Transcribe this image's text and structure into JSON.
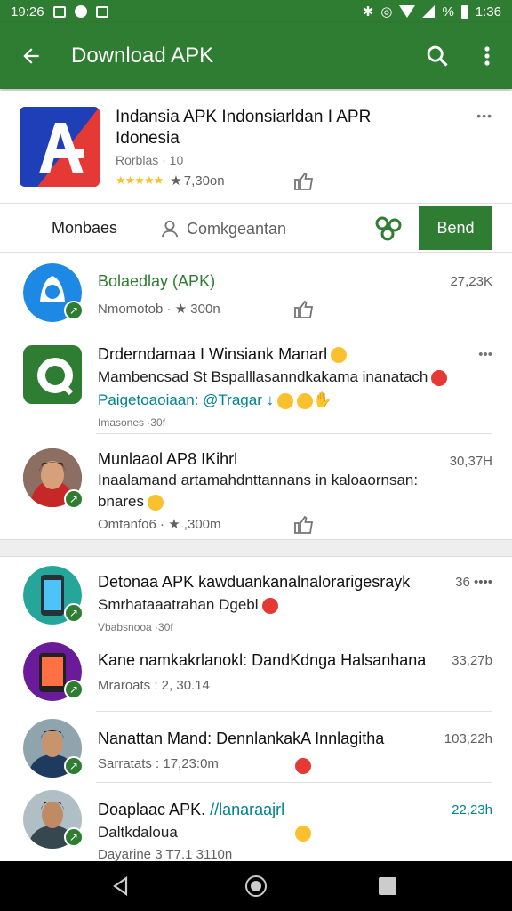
{
  "statusbar": {
    "time_left": "19:26",
    "battery": "%",
    "time_right": "1:36"
  },
  "appbar": {
    "title": "Download APK"
  },
  "hero": {
    "title": "Indansia APK Indonsiarldan I APR Idonesia",
    "subtitle": "Rorblas · 10",
    "stats": "7,30on",
    "more": "•••"
  },
  "tabs": {
    "tab1": "Monbaes",
    "tab2": "Comkgeantan",
    "button": "Bend"
  },
  "items": [
    {
      "title": "Bolaedlay (APK)",
      "meta": "Nmomotob · ★ 300n",
      "right": "27,23K"
    },
    {
      "title": "Drderndamaa I Winsiank Manarl",
      "line2": "Mambencsad St Bspalllasanndkakama inanatach",
      "line3": "Paigetoaoiaan: @Tragar ↓",
      "small": "Imasones ·30f",
      "right": "•••"
    },
    {
      "title": "Munlaaol AP8 IKihrl",
      "line2": "Inaalamand artamahdnttannans in kaloaornsan:",
      "line3": "bnares",
      "meta": "Omtanfo6 · ★ ,300m",
      "right": "30,37H"
    },
    {
      "title": "Detonaa APK kawduankanalnalorarigesrayk",
      "line2": "Smrhataaatrahan Dgebl",
      "small": "Vbabsnooa ·30f",
      "right": "36 ••••"
    },
    {
      "title": "Kane namkakrlanokl: DandKdnga Halsanhana",
      "meta": "Mraroats : 2, 30.14",
      "right": "33,27b"
    },
    {
      "title": "Nanattan Mand: DennlankakA Innlagitha",
      "meta": "Sarratats : 17,23:0m",
      "right": "103,22h"
    },
    {
      "title": "Doaplaac APK.",
      "title_link": "//lanaraajrl",
      "line2": "Daltkdaloua",
      "meta": "Dayarine 3 T7.1 3110n",
      "right": "22,23h"
    }
  ]
}
